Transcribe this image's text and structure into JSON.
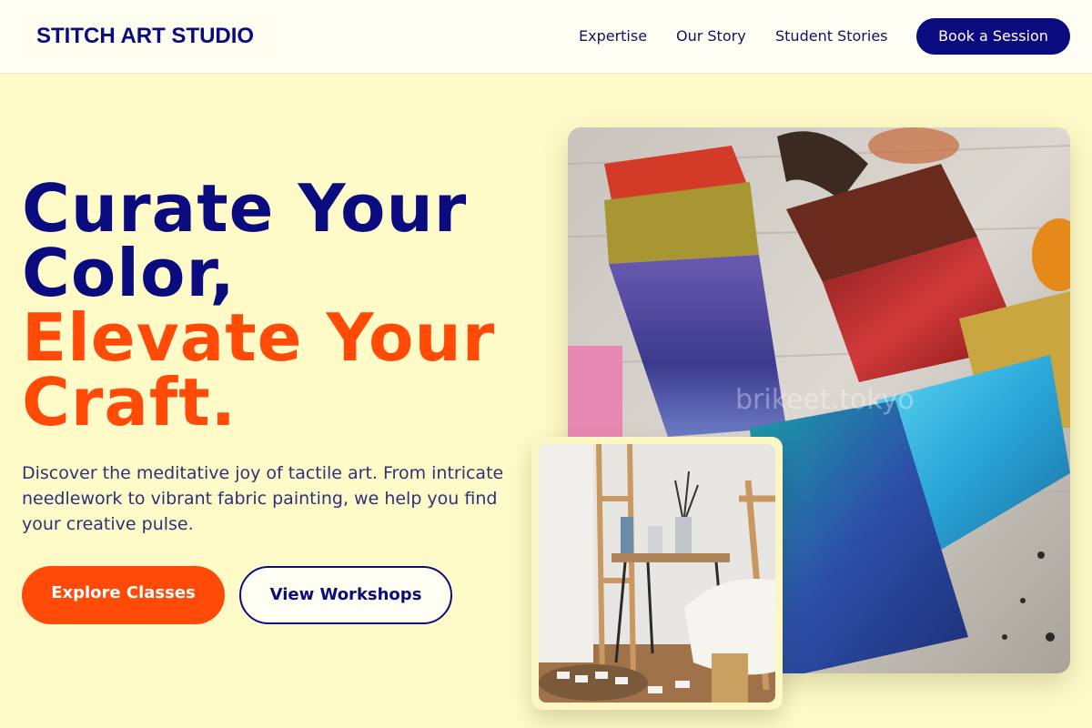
{
  "header": {
    "logo": "STITCH ART STUDIO",
    "nav": [
      "Expertise",
      "Our Story",
      "Student Stories"
    ],
    "cta": "Book a Session"
  },
  "hero": {
    "headline_line1": "Curate Your",
    "headline_line2": "Color,",
    "headline_line3": "Elevate Your",
    "headline_line4": "Craft.",
    "description": "Discover the meditative joy of tactile art. From intricate needlework to vibrant fabric painting, we help you find your creative pulse.",
    "primary_button": "Explore Classes",
    "secondary_button": "View Workshops"
  },
  "images": {
    "main_watermark": "brikeet.tokyo",
    "main_alt_icon": "paint-brushes-photo",
    "inset_alt_icon": "art-studio-photo"
  },
  "colors": {
    "background": "#fefbc8",
    "navy": "#0b0b80",
    "orange": "#ff4a08",
    "body_text": "#2f3178"
  }
}
